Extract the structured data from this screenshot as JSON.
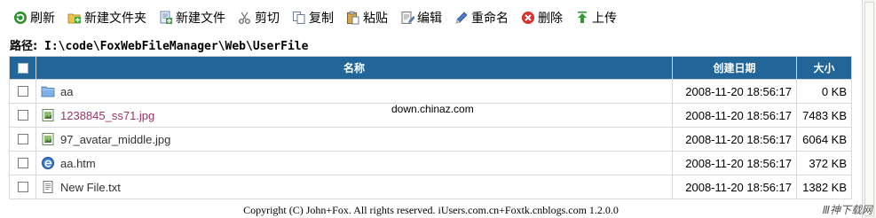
{
  "toolbar": {
    "items": [
      {
        "label": "刷新",
        "icon": "refresh-icon"
      },
      {
        "label": "新建文件夹",
        "icon": "new-folder-icon"
      },
      {
        "label": "新建文件",
        "icon": "new-file-icon"
      },
      {
        "label": "剪切",
        "icon": "scissors-icon"
      },
      {
        "label": "复制",
        "icon": "copy-icon"
      },
      {
        "label": "粘贴",
        "icon": "paste-icon"
      },
      {
        "label": "编辑",
        "icon": "edit-icon"
      },
      {
        "label": "重命名",
        "icon": "pencil-icon"
      },
      {
        "label": "删除",
        "icon": "delete-icon"
      },
      {
        "label": "上传",
        "icon": "upload-icon"
      }
    ]
  },
  "path": {
    "label": "路径:",
    "value": "I:\\code\\FoxWebFileManager\\Web\\UserFile"
  },
  "table": {
    "headers": {
      "name": "名称",
      "date": "创建日期",
      "size": "大小"
    },
    "rows": [
      {
        "name": "aa",
        "type": "folder",
        "date": "2008-11-20 18:56:17",
        "size": "0 KB",
        "visited": false
      },
      {
        "name": "1238845_ss71.jpg",
        "type": "image",
        "date": "2008-11-20 18:56:17",
        "size": "7483 KB",
        "visited": true
      },
      {
        "name": "97_avatar_middle.jpg",
        "type": "image",
        "date": "2008-11-20 18:56:17",
        "size": "6064 KB",
        "visited": false
      },
      {
        "name": "aa.htm",
        "type": "html",
        "date": "2008-11-20 18:56:17",
        "size": "372 KB",
        "visited": false
      },
      {
        "name": "New File.txt",
        "type": "text",
        "date": "2008-11-20 18:56:17",
        "size": "1382 KB",
        "visited": false
      }
    ]
  },
  "watermark": "down.chinaz.com",
  "footer": "Copyright (C) John+Fox. All rights reserved. iUsers.com.cn+Foxtk.cnblogs.com 1.2.0.0",
  "corner_logo": "Ⅲ神下载网",
  "colors": {
    "header_bg": "#226699",
    "visited_link": "#993366"
  }
}
